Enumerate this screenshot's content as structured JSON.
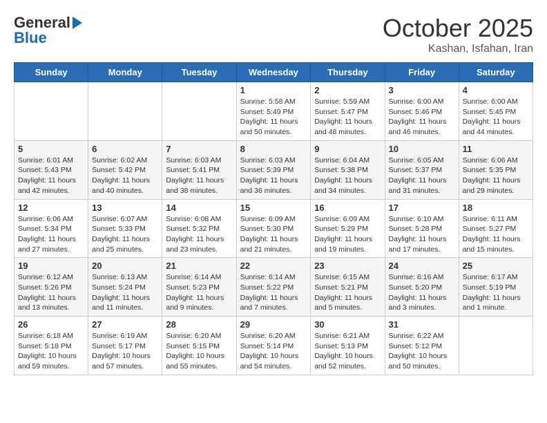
{
  "logo": {
    "text_general": "General",
    "text_blue": "Blue",
    "arrow": "►"
  },
  "header": {
    "month": "October 2025",
    "location": "Kashan, Isfahan, Iran"
  },
  "weekdays": [
    "Sunday",
    "Monday",
    "Tuesday",
    "Wednesday",
    "Thursday",
    "Friday",
    "Saturday"
  ],
  "weeks": [
    [
      {
        "day": "",
        "sunrise": "",
        "sunset": "",
        "daylight": ""
      },
      {
        "day": "",
        "sunrise": "",
        "sunset": "",
        "daylight": ""
      },
      {
        "day": "",
        "sunrise": "",
        "sunset": "",
        "daylight": ""
      },
      {
        "day": "1",
        "sunrise": "Sunrise: 5:58 AM",
        "sunset": "Sunset: 5:49 PM",
        "daylight": "Daylight: 11 hours and 50 minutes."
      },
      {
        "day": "2",
        "sunrise": "Sunrise: 5:59 AM",
        "sunset": "Sunset: 5:47 PM",
        "daylight": "Daylight: 11 hours and 48 minutes."
      },
      {
        "day": "3",
        "sunrise": "Sunrise: 6:00 AM",
        "sunset": "Sunset: 5:46 PM",
        "daylight": "Daylight: 11 hours and 46 minutes."
      },
      {
        "day": "4",
        "sunrise": "Sunrise: 6:00 AM",
        "sunset": "Sunset: 5:45 PM",
        "daylight": "Daylight: 11 hours and 44 minutes."
      }
    ],
    [
      {
        "day": "5",
        "sunrise": "Sunrise: 6:01 AM",
        "sunset": "Sunset: 5:43 PM",
        "daylight": "Daylight: 11 hours and 42 minutes."
      },
      {
        "day": "6",
        "sunrise": "Sunrise: 6:02 AM",
        "sunset": "Sunset: 5:42 PM",
        "daylight": "Daylight: 11 hours and 40 minutes."
      },
      {
        "day": "7",
        "sunrise": "Sunrise: 6:03 AM",
        "sunset": "Sunset: 5:41 PM",
        "daylight": "Daylight: 11 hours and 38 minutes."
      },
      {
        "day": "8",
        "sunrise": "Sunrise: 6:03 AM",
        "sunset": "Sunset: 5:39 PM",
        "daylight": "Daylight: 11 hours and 36 minutes."
      },
      {
        "day": "9",
        "sunrise": "Sunrise: 6:04 AM",
        "sunset": "Sunset: 5:38 PM",
        "daylight": "Daylight: 11 hours and 34 minutes."
      },
      {
        "day": "10",
        "sunrise": "Sunrise: 6:05 AM",
        "sunset": "Sunset: 5:37 PM",
        "daylight": "Daylight: 11 hours and 31 minutes."
      },
      {
        "day": "11",
        "sunrise": "Sunrise: 6:06 AM",
        "sunset": "Sunset: 5:35 PM",
        "daylight": "Daylight: 11 hours and 29 minutes."
      }
    ],
    [
      {
        "day": "12",
        "sunrise": "Sunrise: 6:06 AM",
        "sunset": "Sunset: 5:34 PM",
        "daylight": "Daylight: 11 hours and 27 minutes."
      },
      {
        "day": "13",
        "sunrise": "Sunrise: 6:07 AM",
        "sunset": "Sunset: 5:33 PM",
        "daylight": "Daylight: 11 hours and 25 minutes."
      },
      {
        "day": "14",
        "sunrise": "Sunrise: 6:08 AM",
        "sunset": "Sunset: 5:32 PM",
        "daylight": "Daylight: 11 hours and 23 minutes."
      },
      {
        "day": "15",
        "sunrise": "Sunrise: 6:09 AM",
        "sunset": "Sunset: 5:30 PM",
        "daylight": "Daylight: 11 hours and 21 minutes."
      },
      {
        "day": "16",
        "sunrise": "Sunrise: 6:09 AM",
        "sunset": "Sunset: 5:29 PM",
        "daylight": "Daylight: 11 hours and 19 minutes."
      },
      {
        "day": "17",
        "sunrise": "Sunrise: 6:10 AM",
        "sunset": "Sunset: 5:28 PM",
        "daylight": "Daylight: 11 hours and 17 minutes."
      },
      {
        "day": "18",
        "sunrise": "Sunrise: 6:11 AM",
        "sunset": "Sunset: 5:27 PM",
        "daylight": "Daylight: 11 hours and 15 minutes."
      }
    ],
    [
      {
        "day": "19",
        "sunrise": "Sunrise: 6:12 AM",
        "sunset": "Sunset: 5:26 PM",
        "daylight": "Daylight: 11 hours and 13 minutes."
      },
      {
        "day": "20",
        "sunrise": "Sunrise: 6:13 AM",
        "sunset": "Sunset: 5:24 PM",
        "daylight": "Daylight: 11 hours and 11 minutes."
      },
      {
        "day": "21",
        "sunrise": "Sunrise: 6:14 AM",
        "sunset": "Sunset: 5:23 PM",
        "daylight": "Daylight: 11 hours and 9 minutes."
      },
      {
        "day": "22",
        "sunrise": "Sunrise: 6:14 AM",
        "sunset": "Sunset: 5:22 PM",
        "daylight": "Daylight: 11 hours and 7 minutes."
      },
      {
        "day": "23",
        "sunrise": "Sunrise: 6:15 AM",
        "sunset": "Sunset: 5:21 PM",
        "daylight": "Daylight: 11 hours and 5 minutes."
      },
      {
        "day": "24",
        "sunrise": "Sunrise: 6:16 AM",
        "sunset": "Sunset: 5:20 PM",
        "daylight": "Daylight: 11 hours and 3 minutes."
      },
      {
        "day": "25",
        "sunrise": "Sunrise: 6:17 AM",
        "sunset": "Sunset: 5:19 PM",
        "daylight": "Daylight: 11 hours and 1 minute."
      }
    ],
    [
      {
        "day": "26",
        "sunrise": "Sunrise: 6:18 AM",
        "sunset": "Sunset: 5:18 PM",
        "daylight": "Daylight: 10 hours and 59 minutes."
      },
      {
        "day": "27",
        "sunrise": "Sunrise: 6:19 AM",
        "sunset": "Sunset: 5:17 PM",
        "daylight": "Daylight: 10 hours and 57 minutes."
      },
      {
        "day": "28",
        "sunrise": "Sunrise: 6:20 AM",
        "sunset": "Sunset: 5:15 PM",
        "daylight": "Daylight: 10 hours and 55 minutes."
      },
      {
        "day": "29",
        "sunrise": "Sunrise: 6:20 AM",
        "sunset": "Sunset: 5:14 PM",
        "daylight": "Daylight: 10 hours and 54 minutes."
      },
      {
        "day": "30",
        "sunrise": "Sunrise: 6:21 AM",
        "sunset": "Sunset: 5:13 PM",
        "daylight": "Daylight: 10 hours and 52 minutes."
      },
      {
        "day": "31",
        "sunrise": "Sunrise: 6:22 AM",
        "sunset": "Sunset: 5:12 PM",
        "daylight": "Daylight: 10 hours and 50 minutes."
      },
      {
        "day": "",
        "sunrise": "",
        "sunset": "",
        "daylight": ""
      }
    ]
  ]
}
